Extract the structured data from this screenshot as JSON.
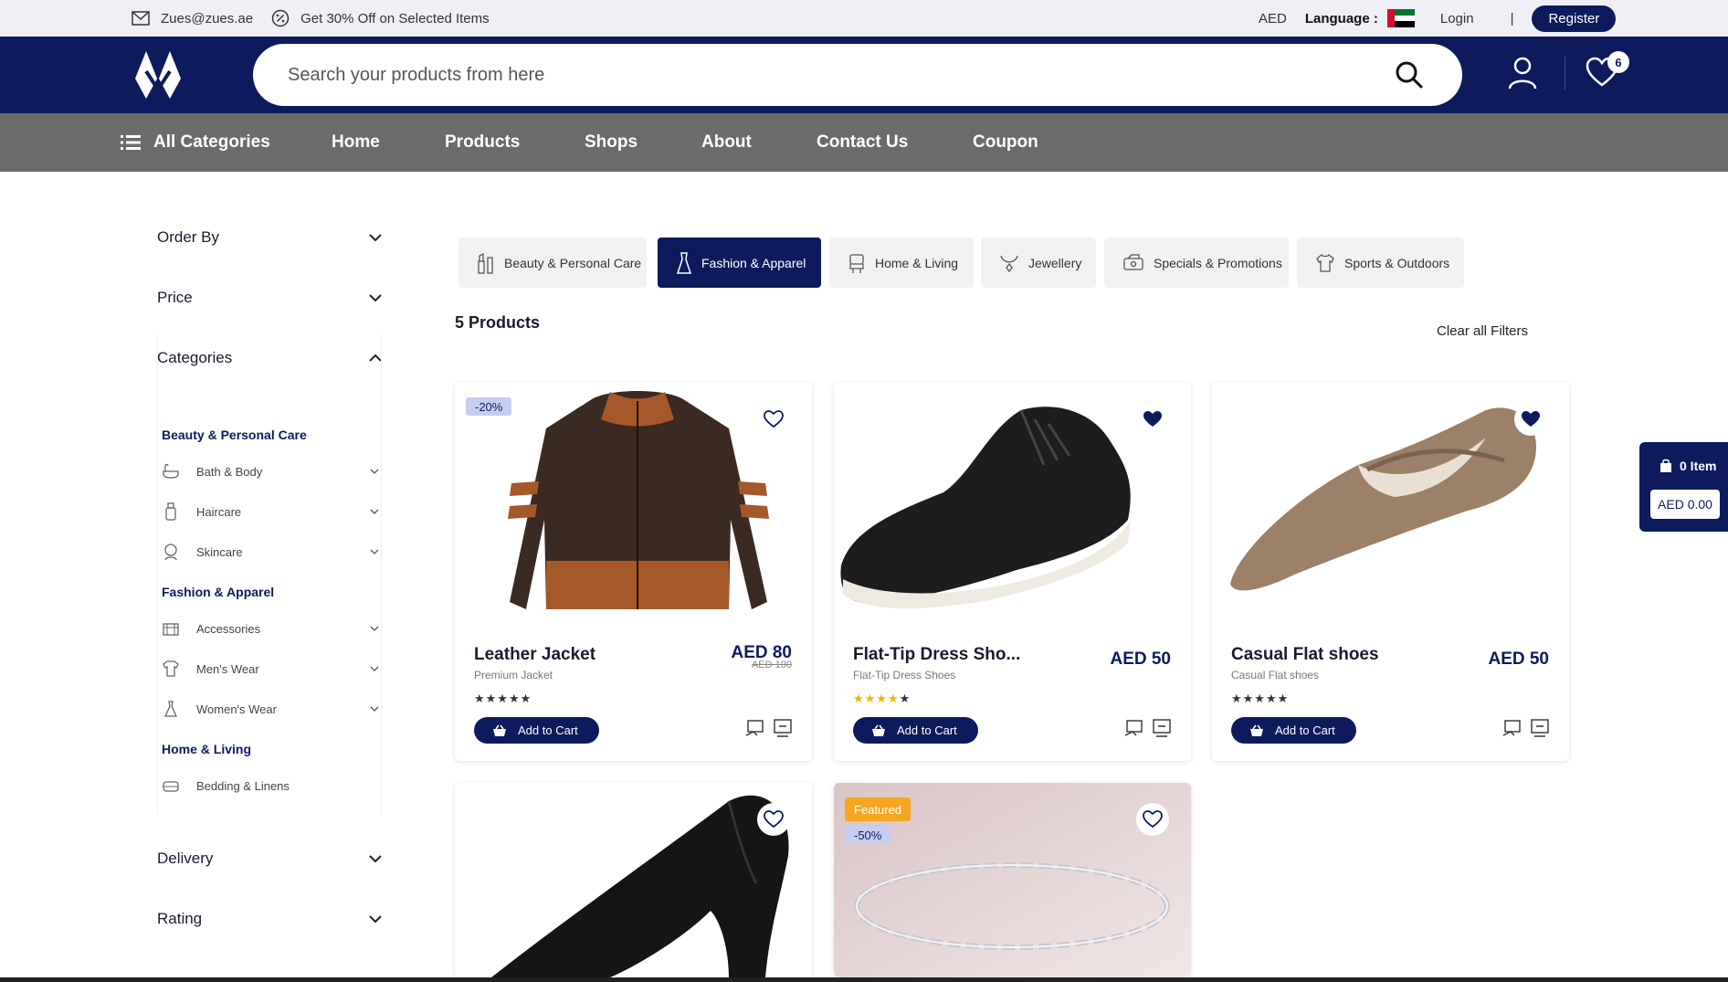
{
  "topbar": {
    "email": "Zues@zues.ae",
    "promo": "Get 30% Off on Selected Items",
    "currency": "AED",
    "language_label": "Language :",
    "login": "Login",
    "separator": "|",
    "register": "Register"
  },
  "header": {
    "search_placeholder": "Search your products from here",
    "wishlist_count": "6"
  },
  "nav": {
    "all_categories": "All Categories",
    "items": [
      "Home",
      "Products",
      "Shops",
      "About",
      "Contact Us",
      "Coupon"
    ]
  },
  "sidebar": {
    "order_by": "Order By",
    "price": "Price",
    "categories": "Categories",
    "delivery": "Delivery",
    "rating": "Rating",
    "groups": [
      {
        "label": "Beauty & Personal Care",
        "items": [
          "Bath & Body",
          "Haircare",
          "Skincare"
        ]
      },
      {
        "label": "Fashion & Apparel",
        "items": [
          "Accessories",
          "Men's Wear",
          "Women's Wear"
        ]
      },
      {
        "label": "Home & Living",
        "items": [
          "Bedding & Linens"
        ]
      }
    ]
  },
  "tabs": [
    {
      "label": "Beauty & Personal Care",
      "active": false
    },
    {
      "label": "Fashion & Apparel",
      "active": true
    },
    {
      "label": "Home & Living",
      "active": false
    },
    {
      "label": "Jewellery",
      "active": false
    },
    {
      "label": "Specials & Promotions",
      "active": false
    },
    {
      "label": "Sports & Outdoors",
      "active": false
    }
  ],
  "results": {
    "count": "5 Products",
    "clear": "Clear all Filters"
  },
  "products": [
    {
      "name": "Leather Jacket",
      "subtitle": "Premium Jacket",
      "price": "AED 80",
      "old_price": "AED 100",
      "badge": "-20%",
      "rating": 0,
      "stars": "★★★★★",
      "add_to_cart": "Add to Cart",
      "wishlisted": false
    },
    {
      "name": "Flat-Tip Dress Sho...",
      "subtitle": "Flat-Tip Dress Shoes",
      "price": "AED 50",
      "rating": 4,
      "stars": "★★★★★",
      "add_to_cart": "Add to Cart",
      "wishlisted": true
    },
    {
      "name": "Casual Flat shoes",
      "subtitle": "Casual Flat shoes",
      "price": "AED 50",
      "rating": 0,
      "stars": "★★★★★",
      "add_to_cart": "Add to Cart",
      "wishlisted": true
    },
    {
      "wishlisted": false
    },
    {
      "featured": "Featured",
      "badge": "-50%",
      "wishlisted": false
    }
  ],
  "minicart": {
    "items": "0 Item",
    "total": "AED 0.00"
  },
  "colors": {
    "brand_navy": "#0d1b5c",
    "nav_gray": "#6b6b6b",
    "featured_orange": "#f5a623",
    "star_gold": "#f5b301"
  }
}
